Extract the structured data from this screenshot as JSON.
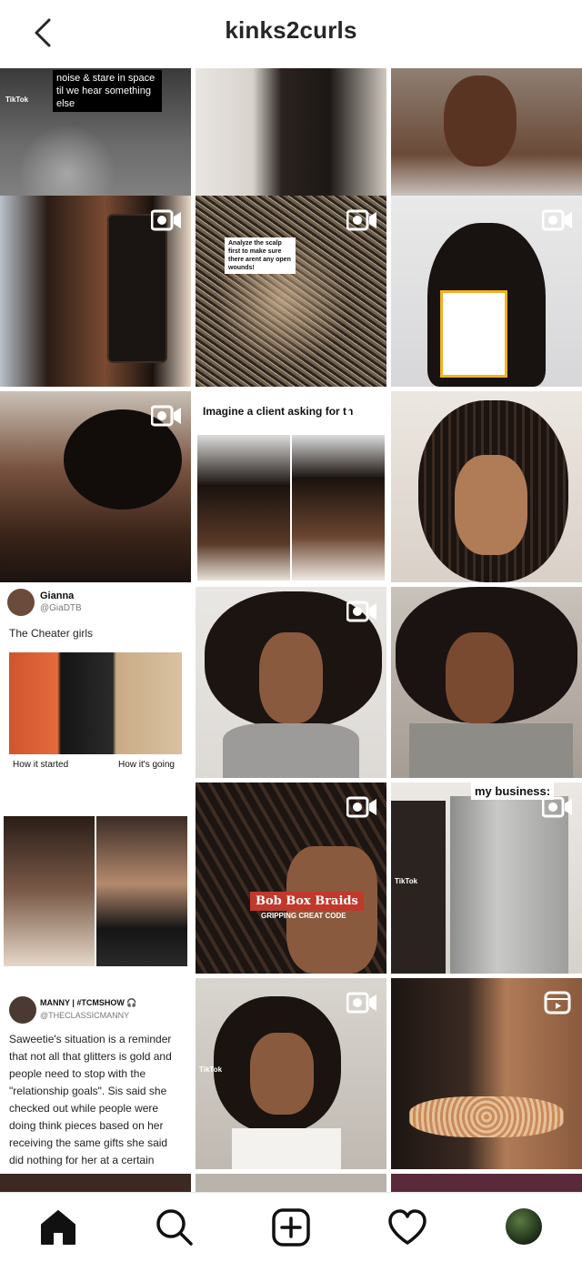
{
  "header": {
    "title": "kinks2curls",
    "back_icon": "chevron-left-icon"
  },
  "posts": [
    {
      "caption": "noise & stare in space til we hear something else",
      "badge": "TikTok",
      "type": "image"
    },
    {
      "type": "image"
    },
    {
      "type": "image"
    },
    {
      "type": "video"
    },
    {
      "type": "video",
      "caption": "Analyze the scalp first to make sure there arent any open wounds!"
    },
    {
      "type": "video"
    },
    {
      "type": "video"
    },
    {
      "type": "video",
      "caption": "Imagine a client asking for th"
    },
    {
      "type": "image"
    },
    {
      "type": "tweet",
      "name": "Gianna",
      "handle": "@GiaDTB",
      "text": "The Cheater girls",
      "lower_left": "How it started",
      "lower_right": "How it's going"
    },
    {
      "type": "video"
    },
    {
      "type": "image"
    },
    {
      "type": "video",
      "caption": "Bob Box Braids",
      "subcaption": "GRIPPING CREAT CODE"
    },
    {
      "type": "video",
      "caption": "my business:",
      "badge": "TikTok"
    },
    {
      "type": "tweet",
      "name": "MANNY | #TCMSHOW 🎧",
      "handle": "@THECLASSICMANNY",
      "text": "Saweetie's situation is a reminder that not all that glitters is gold and people need to stop with the \"relationship goals\". Sis said she checked out while people were doing think pieces based on her receiving the same gifts she said did nothing for her at a certain point."
    },
    {
      "type": "video",
      "badge": "TikTok"
    },
    {
      "type": "reel"
    }
  ],
  "nav": {
    "home": "home-icon",
    "search": "search-icon",
    "create": "add-post-icon",
    "activity": "heart-icon",
    "profile": "profile-avatar"
  },
  "colors": {
    "text": "#262626",
    "divider": "#e6e6e6",
    "accent_red": "#c0392b"
  }
}
